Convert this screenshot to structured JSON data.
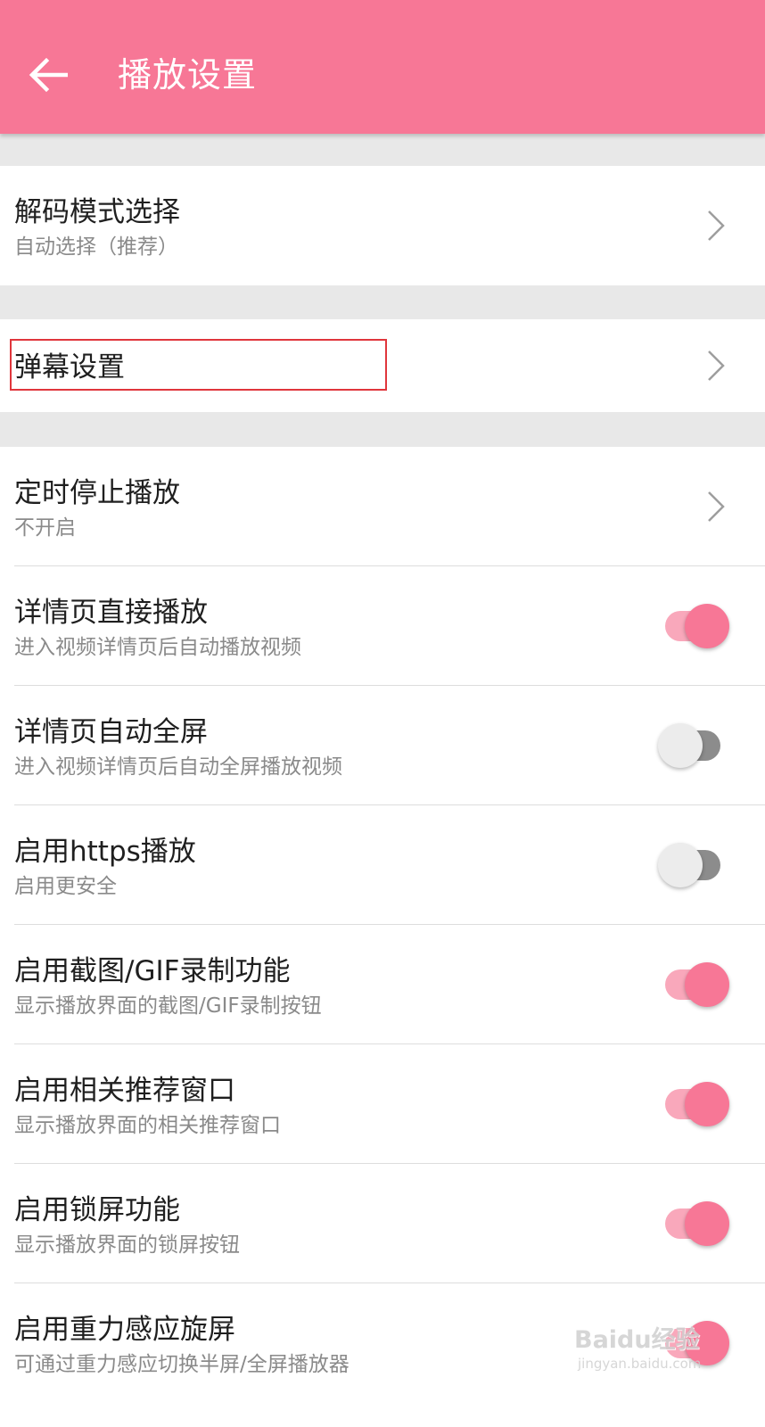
{
  "header": {
    "title": "播放设置",
    "background_color": "#f77796",
    "back_icon": "arrow-left-icon"
  },
  "sections": [
    {
      "rows": [
        {
          "title": "解码模式选择",
          "subtitle": "自动选择（推荐）",
          "control": "chevron"
        }
      ]
    },
    {
      "rows": [
        {
          "title": "弹幕设置",
          "control": "chevron",
          "highlighted": true
        }
      ]
    },
    {
      "rows": [
        {
          "title": "定时停止播放",
          "subtitle": "不开启",
          "control": "chevron"
        },
        {
          "title": "详情页直接播放",
          "subtitle": "进入视频详情页后自动播放视频",
          "control": "toggle",
          "on": true
        },
        {
          "title": "详情页自动全屏",
          "subtitle": "进入视频详情页后自动全屏播放视频",
          "control": "toggle",
          "on": false
        },
        {
          "title": "启用https播放",
          "subtitle": "启用更安全",
          "control": "toggle",
          "on": false
        },
        {
          "title": "启用截图/GIF录制功能",
          "subtitle": "显示播放界面的截图/GIF录制按钮",
          "control": "toggle",
          "on": true
        },
        {
          "title": "启用相关推荐窗口",
          "subtitle": "显示播放界面的相关推荐窗口",
          "control": "toggle",
          "on": true
        },
        {
          "title": "启用锁屏功能",
          "subtitle": "显示播放界面的锁屏按钮",
          "control": "toggle",
          "on": true
        },
        {
          "title": "启用重力感应旋屏",
          "subtitle": "可通过重力感应切换半屏/全屏播放器",
          "control": "toggle",
          "on": true
        }
      ]
    }
  ],
  "colors": {
    "accent": "#f77796",
    "toggle_on_track": "#f9a8bb",
    "toggle_off_track": "#8c8c8c",
    "toggle_off_knob": "#ececec",
    "highlight_border": "#e0363c"
  },
  "watermark": {
    "main": "Baidu经验",
    "sub": "jingyan.baidu.com"
  }
}
